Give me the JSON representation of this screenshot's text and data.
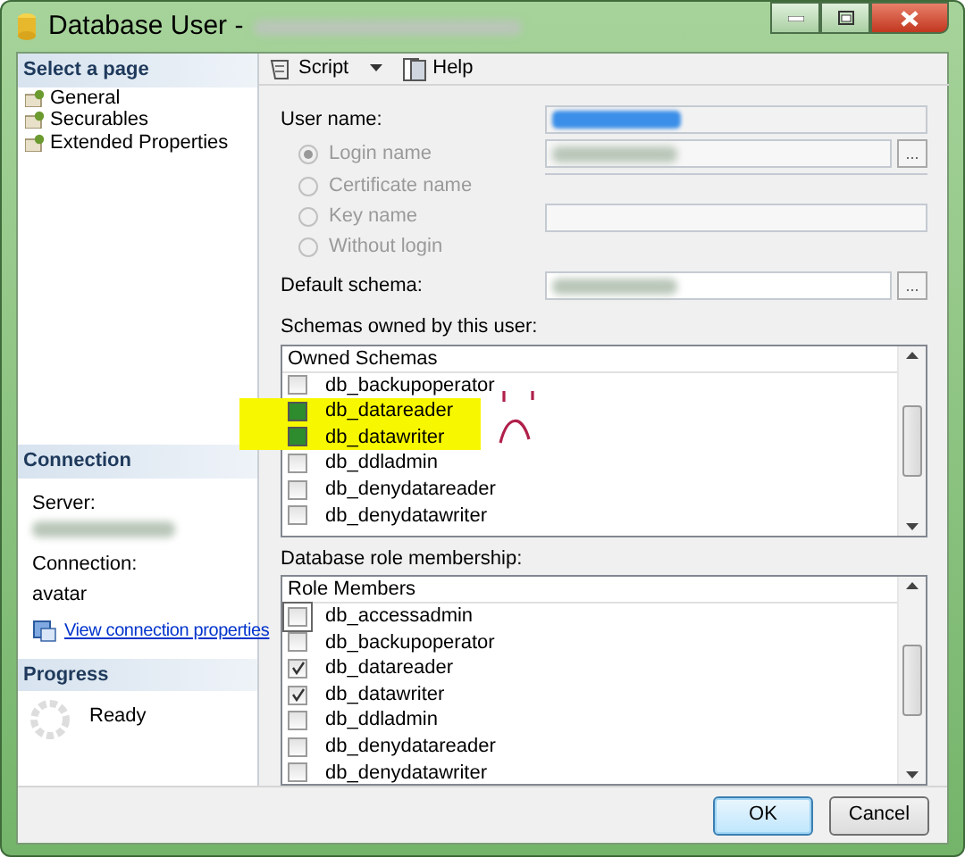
{
  "window": {
    "title": "Database User -",
    "title_redacted": true
  },
  "sidebar": {
    "header": "Select a page",
    "pages": [
      {
        "label": "General"
      },
      {
        "label": "Securables"
      },
      {
        "label": "Extended Properties"
      }
    ]
  },
  "connection": {
    "header": "Connection",
    "server_label": "Server:",
    "server_redacted": true,
    "connection_label": "Connection:",
    "connection_value": "avatar",
    "link": "View connection properties"
  },
  "progress": {
    "header": "Progress",
    "status": "Ready"
  },
  "toolbar": [
    {
      "label": "Script",
      "kind": "dropdown"
    },
    {
      "label": "Help",
      "kind": "plain"
    }
  ],
  "form": {
    "user_name_label": "User name:",
    "user_name_redacted": true,
    "login_options": [
      {
        "label": "Login name",
        "selected": true,
        "redacted": true,
        "browse_label": "..."
      },
      {
        "label": "Certificate name",
        "selected": false
      },
      {
        "label": "Key name",
        "selected": false
      },
      {
        "label": "Without login",
        "selected": false
      }
    ],
    "default_schema_label": "Default schema:",
    "default_schema_redacted": true,
    "default_schema_browse_label": "..."
  },
  "owned_schemas": {
    "label": "Schemas owned by this user:",
    "column": "Owned Schemas",
    "rows": [
      {
        "name": "db_backupoperator",
        "checked": false,
        "highlighted": false
      },
      {
        "name": "db_datareader",
        "checked": true,
        "highlighted": true
      },
      {
        "name": "db_datawriter",
        "checked": true,
        "highlighted": true
      },
      {
        "name": "db_ddladmin",
        "checked": false,
        "highlighted": false
      },
      {
        "name": "db_denydatareader",
        "checked": false,
        "highlighted": false
      },
      {
        "name": "db_denydatawriter",
        "checked": false,
        "highlighted": false
      }
    ]
  },
  "role_membership": {
    "label": "Database role membership:",
    "column": "Role Members",
    "rows": [
      {
        "name": "db_accessadmin",
        "checked": false,
        "focused": true
      },
      {
        "name": "db_backupoperator",
        "checked": false
      },
      {
        "name": "db_datareader",
        "checked": true
      },
      {
        "name": "db_datawriter",
        "checked": true
      },
      {
        "name": "db_ddladmin",
        "checked": false
      },
      {
        "name": "db_denydatareader",
        "checked": false
      },
      {
        "name": "db_denydatawriter",
        "checked": false
      }
    ]
  },
  "buttons": [
    {
      "label": "OK",
      "default": true
    },
    {
      "label": "Cancel",
      "default": false
    }
  ]
}
